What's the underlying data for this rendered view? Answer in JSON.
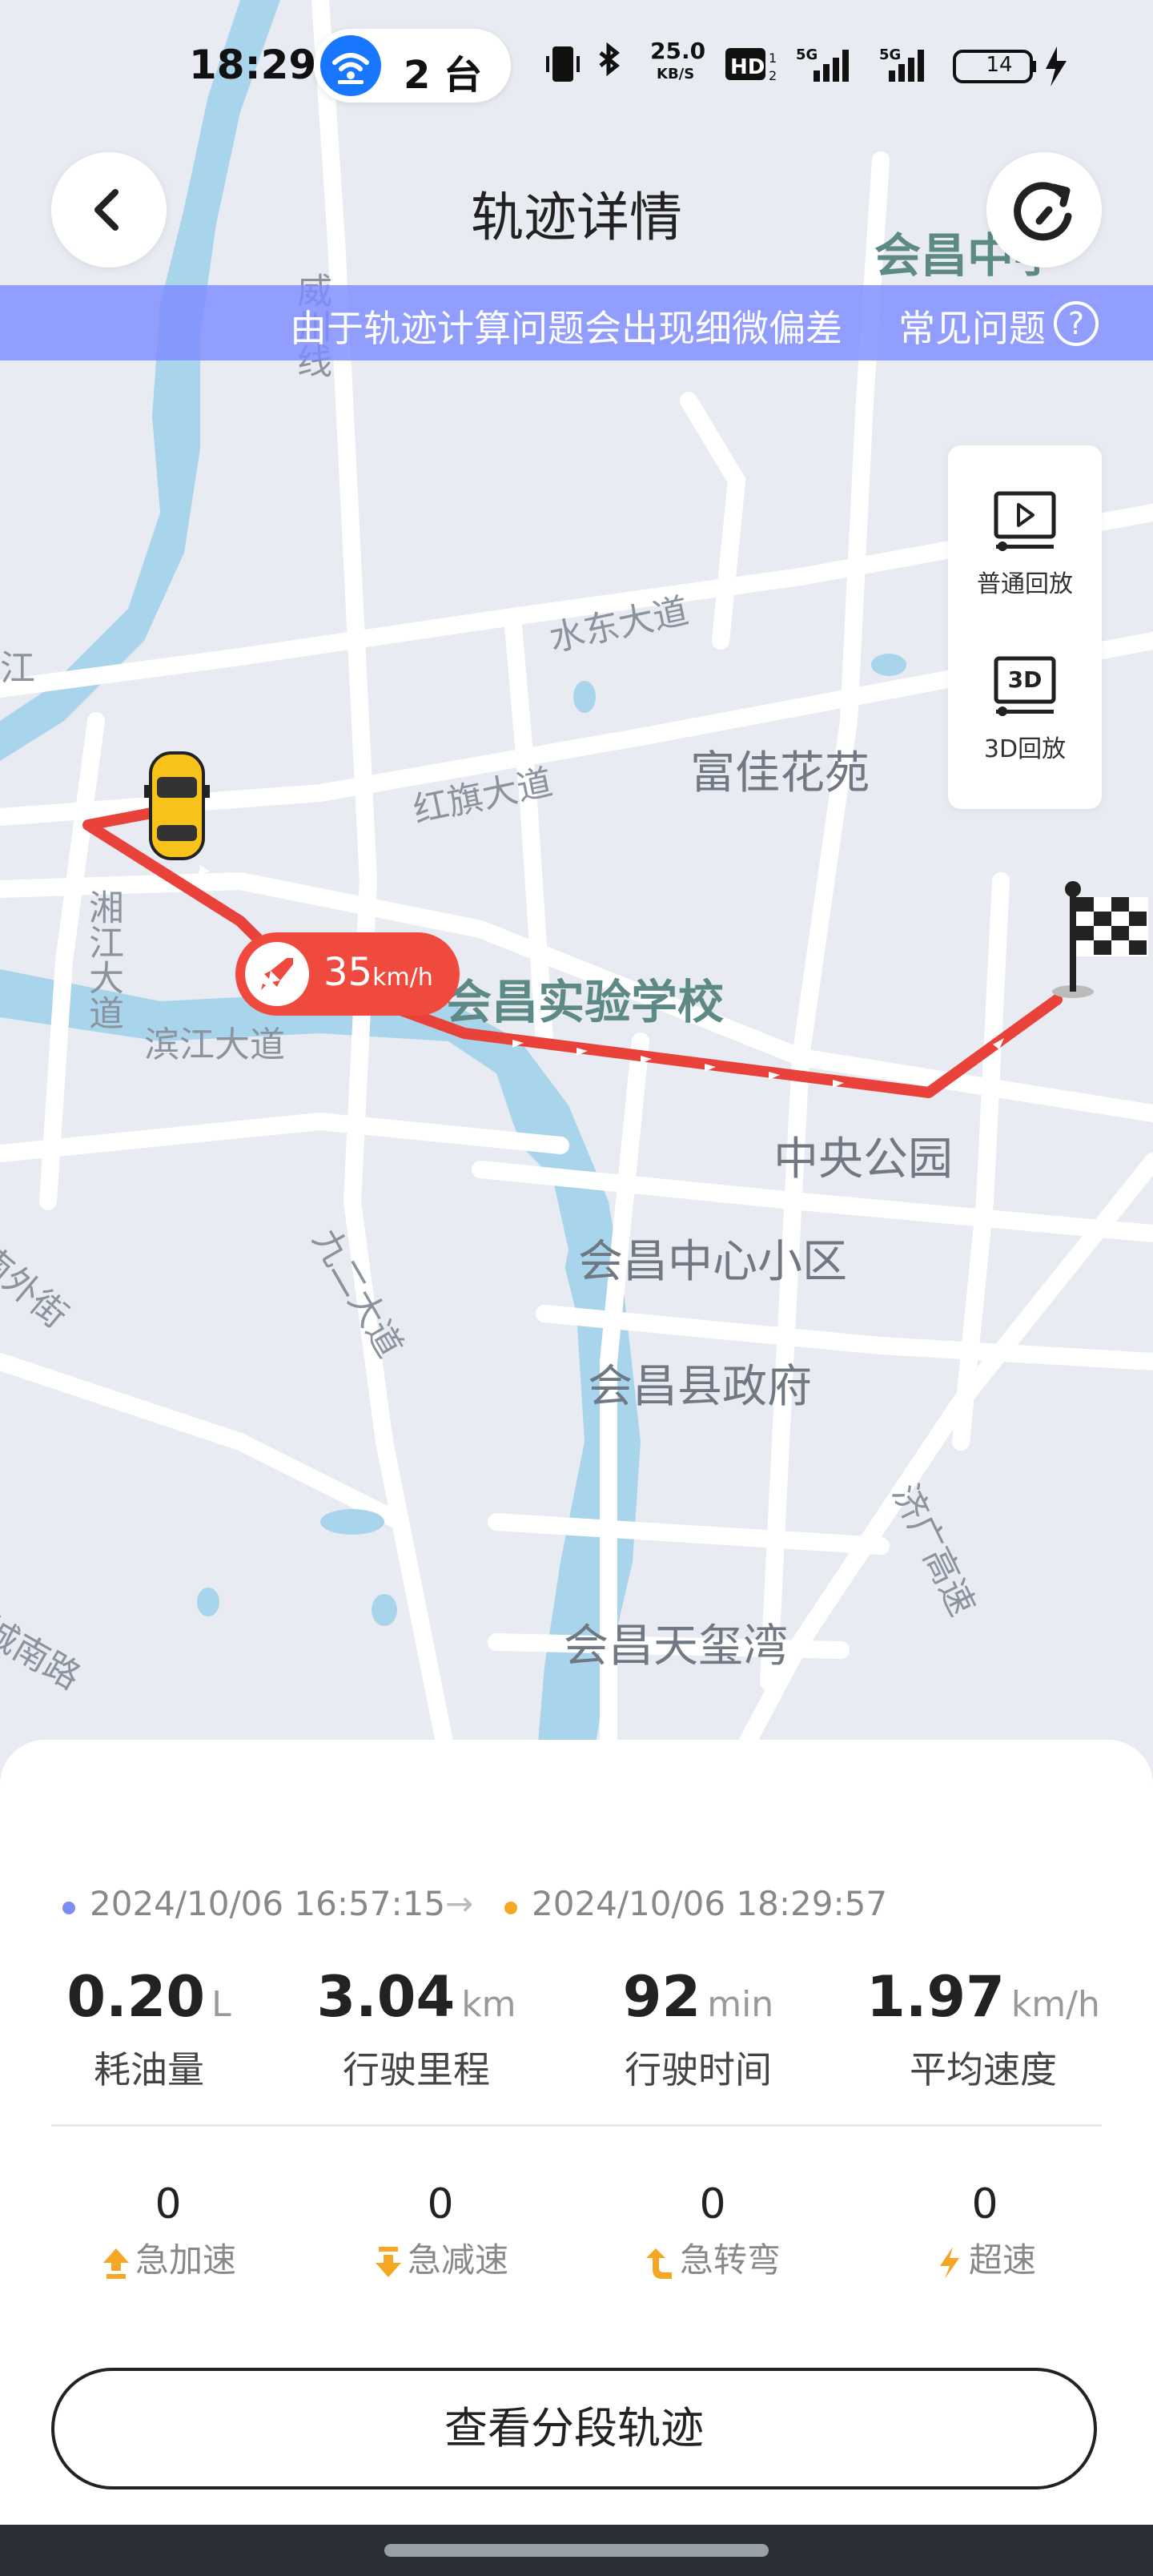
{
  "status_bar": {
    "time": "18:29",
    "hotspot_count": "2 台",
    "net_speed_value": "25.0",
    "net_speed_unit": "KB/S",
    "battery": "14",
    "icons": [
      "vibrate-icon",
      "bluetooth-icon",
      "hd-icon",
      "signal-5g-icon",
      "signal-5g-icon",
      "battery-icon",
      "charging-icon"
    ]
  },
  "header": {
    "title": "轨迹详情",
    "back_icon": "chevron-left-icon",
    "refresh_icon": "refresh-icon"
  },
  "notice": {
    "text": "由于轨迹计算问题会出现细微偏差",
    "faq_label": "常见问题",
    "faq_icon": "question-circle-icon"
  },
  "replay": {
    "normal_label": "普通回放",
    "three_d_label": "3D回放",
    "three_d_badge": "3D"
  },
  "map": {
    "labels": {
      "school": "会昌实验学校",
      "garden": "富佳花苑",
      "park": "中央公园",
      "center_district": "会昌中心小区",
      "gov": "会昌县政府",
      "tianxi": "会昌天玺湾",
      "shuidong": "水东大道",
      "hongqi": "红旗大道",
      "binjiang": "滨江大道",
      "xiangjiang": "湘江大道",
      "jiuer": "九二大道",
      "xianchuan": "威川线",
      "jiguang": "济广高速",
      "chengnan": "城南路",
      "nanwai": "南外街",
      "huichang_mid": "会昌中学",
      "jiang": "江"
    },
    "speed_badge_value": "35",
    "speed_badge_unit": "km/h",
    "colors": {
      "route": "#e8423a",
      "water": "#a8d4ec",
      "banner": "#7e8cff"
    }
  },
  "trip": {
    "start_time": "2024/10/06 16:57:15",
    "arrow": "→",
    "end_time": "2024/10/06 18:29:57",
    "start_dot_color": "#7b8cf5",
    "end_dot_color": "#f5a623",
    "stats": [
      {
        "value": "0.20",
        "unit": "L",
        "label": "耗油量"
      },
      {
        "value": "3.04",
        "unit": "km",
        "label": "行驶里程"
      },
      {
        "value": "92",
        "unit": "min",
        "label": "行驶时间"
      },
      {
        "value": "1.97",
        "unit": "km/h",
        "label": "平均速度"
      }
    ],
    "events": [
      {
        "count": "0",
        "label": "急加速",
        "icon": "accelerate-up-icon"
      },
      {
        "count": "0",
        "label": "急减速",
        "icon": "decelerate-down-icon"
      },
      {
        "count": "0",
        "label": "急转弯",
        "icon": "sharp-turn-icon"
      },
      {
        "count": "0",
        "label": "超速",
        "icon": "lightning-icon"
      }
    ],
    "segment_button": "查看分段轨迹"
  }
}
